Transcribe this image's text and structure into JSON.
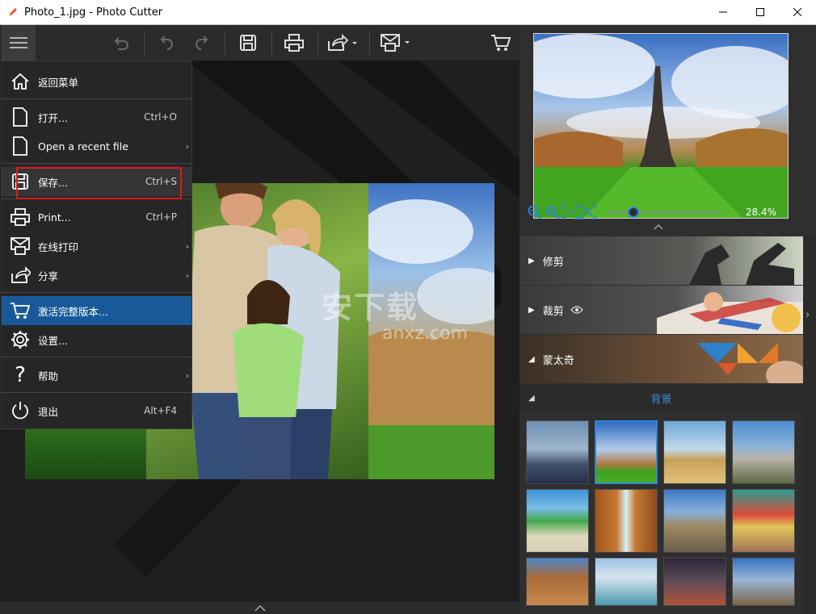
{
  "window": {
    "title": "Photo_1.jpg - Photo Cutter",
    "icons": [
      "pencil-app-icon",
      "minimize-icon",
      "maximize-icon",
      "close-icon"
    ]
  },
  "toolbar": {
    "icons": [
      "hamburger-menu-icon",
      "undo-all-icon",
      "undo-icon",
      "redo-icon",
      "save-icon",
      "print-icon",
      "share-icon",
      "online-print-icon",
      "cart-icon"
    ]
  },
  "menu": {
    "items": [
      {
        "label": "返回菜单",
        "shortcut": "",
        "icon": "home-icon",
        "submenu": false
      },
      {
        "label": "打开...",
        "shortcut": "Ctrl+O",
        "icon": "open-file-icon",
        "submenu": false
      },
      {
        "label": "Open a recent file",
        "shortcut": "",
        "icon": "recent-file-icon",
        "submenu": true
      },
      {
        "label": "保存...",
        "shortcut": "Ctrl+S",
        "icon": "save-icon",
        "submenu": false
      },
      {
        "label": "Print...",
        "shortcut": "Ctrl+P",
        "icon": "print-icon",
        "submenu": false
      },
      {
        "label": "在线打印",
        "shortcut": "",
        "icon": "online-print-icon",
        "submenu": true
      },
      {
        "label": "分享",
        "shortcut": "",
        "icon": "share-icon",
        "submenu": true
      },
      {
        "label": "激活完整版本...",
        "shortcut": "",
        "icon": "cart-icon",
        "submenu": false
      },
      {
        "label": "设置...",
        "shortcut": "",
        "icon": "gear-icon",
        "submenu": false
      },
      {
        "label": "帮助",
        "shortcut": "",
        "icon": "help-icon",
        "submenu": true
      },
      {
        "label": "退出",
        "shortcut": "Alt+F4",
        "icon": "power-icon",
        "submenu": false
      }
    ],
    "active_item": "激活完整版本...",
    "highlighted_item": "保存..."
  },
  "preview": {
    "zoom_value": "28.4%",
    "zoom_fraction": 0.22
  },
  "sections": {
    "trim": "修剪",
    "crop": "裁剪",
    "montage": "蒙太奇",
    "background": "背景"
  },
  "watermark": {
    "text": "安下载",
    "sub": "anxz.com"
  },
  "colors": {
    "accent_blue": "#19599a",
    "link_blue": "#3a8ddc",
    "highlight_red": "#e01919",
    "panel_dark": "#2f2f2f"
  },
  "thumbnails": [
    {
      "name": "brooklyn-bridge"
    },
    {
      "name": "eiffel-tower",
      "selected": true
    },
    {
      "name": "pyramids"
    },
    {
      "name": "mount-rushmore"
    },
    {
      "name": "tropical-beach"
    },
    {
      "name": "waterfall"
    },
    {
      "name": "desert-road"
    },
    {
      "name": "bicycle-wall"
    },
    {
      "name": "canyon"
    },
    {
      "name": "coastal-city"
    },
    {
      "name": "lightning-desert"
    },
    {
      "name": "mountain-valley"
    }
  ]
}
